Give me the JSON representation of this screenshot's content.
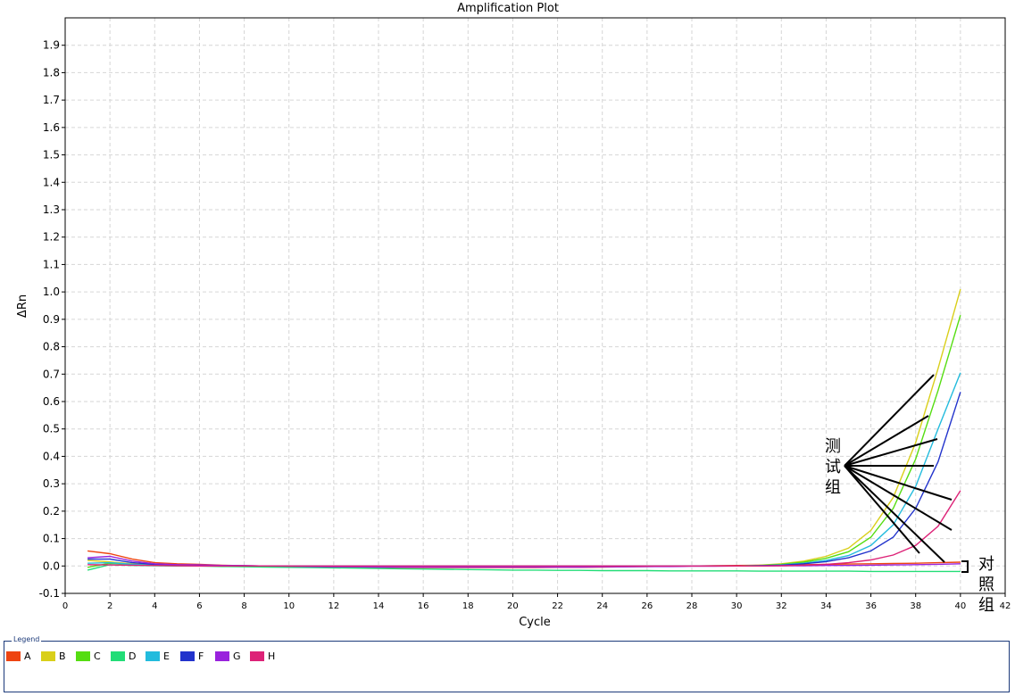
{
  "chart_data": {
    "type": "line",
    "title": "Amplification Plot",
    "xlabel": "Cycle",
    "ylabel": "ΔRn",
    "xlim": [
      0,
      42
    ],
    "ylim": [
      -0.1,
      2.0
    ],
    "xticks": [
      0,
      2,
      4,
      6,
      8,
      10,
      12,
      14,
      16,
      18,
      20,
      22,
      24,
      26,
      28,
      30,
      32,
      34,
      36,
      38,
      40,
      42
    ],
    "yticks": [
      -0.1,
      0.0,
      0.1,
      0.2,
      0.3,
      0.4,
      0.5,
      0.6,
      0.7,
      0.8,
      0.9,
      1.0,
      1.1,
      1.2,
      1.3,
      1.4,
      1.5,
      1.6,
      1.7,
      1.8,
      1.9
    ],
    "ytick_labels": [
      "-0.1",
      "0.0",
      "0.1",
      "0.2",
      "0.3",
      "0.4",
      "0.5",
      "0.6",
      "0.7",
      "0.8",
      "0.9",
      "1.0",
      "1.1",
      "1.2",
      "1.3",
      "1.4",
      "1.5",
      "1.6",
      "1.7",
      "1.8",
      "1.9"
    ],
    "grid": true,
    "x": [
      1,
      2,
      3,
      4,
      5,
      6,
      7,
      8,
      9,
      10,
      11,
      12,
      13,
      14,
      15,
      16,
      17,
      18,
      19,
      20,
      21,
      22,
      23,
      24,
      25,
      26,
      27,
      28,
      29,
      30,
      31,
      32,
      33,
      34,
      35,
      36,
      37,
      38,
      39,
      40
    ],
    "series": [
      {
        "name": "A",
        "color": "#ee4411",
        "values": [
          0.055,
          0.045,
          0.025,
          0.012,
          0.008,
          0.006,
          0.003,
          0.001,
          0.0,
          -0.002,
          -0.004,
          -0.005,
          -0.005,
          -0.006,
          -0.006,
          -0.006,
          -0.006,
          -0.006,
          -0.006,
          -0.006,
          -0.006,
          -0.005,
          -0.005,
          -0.004,
          -0.003,
          -0.002,
          -0.001,
          0.0,
          0.001,
          0.002,
          0.003,
          0.004,
          0.005,
          0.006,
          0.007,
          0.008,
          0.009,
          0.01,
          0.012,
          0.014
        ]
      },
      {
        "name": "B",
        "color": "#d9cf1a",
        "values": [
          0.02,
          0.015,
          0.008,
          0.005,
          0.003,
          0.002,
          0.001,
          0.0,
          0.0,
          0.0,
          0.0,
          0.0,
          0.0,
          0.0,
          0.0,
          0.0,
          0.0,
          0.0,
          0.0,
          0.0,
          0.0,
          0.0,
          0.0,
          0.0,
          0.0,
          0.0,
          0.0,
          0.0,
          0.0,
          0.0,
          0.003,
          0.008,
          0.018,
          0.035,
          0.065,
          0.13,
          0.25,
          0.45,
          0.72,
          1.01
        ]
      },
      {
        "name": "C",
        "color": "#55dd11",
        "values": [
          -0.005,
          0.01,
          0.006,
          0.003,
          0.002,
          0.001,
          0.0,
          0.0,
          0.0,
          0.0,
          0.0,
          0.0,
          0.0,
          0.0,
          0.0,
          0.0,
          0.0,
          0.0,
          0.0,
          0.0,
          0.0,
          0.0,
          0.0,
          0.0,
          0.0,
          0.0,
          0.0,
          0.0,
          0.0,
          0.0,
          0.002,
          0.006,
          0.014,
          0.028,
          0.052,
          0.105,
          0.21,
          0.39,
          0.64,
          0.915
        ]
      },
      {
        "name": "D",
        "color": "#22dd77",
        "values": [
          -0.015,
          0.005,
          0.002,
          0.001,
          0.0,
          0.0,
          -0.002,
          -0.003,
          -0.004,
          -0.005,
          -0.006,
          -0.007,
          -0.008,
          -0.009,
          -0.01,
          -0.011,
          -0.012,
          -0.013,
          -0.014,
          -0.015,
          -0.015,
          -0.016,
          -0.016,
          -0.017,
          -0.017,
          -0.017,
          -0.018,
          -0.018,
          -0.018,
          -0.018,
          -0.019,
          -0.019,
          -0.019,
          -0.019,
          -0.019,
          -0.02,
          -0.02,
          -0.02,
          -0.02,
          -0.02
        ]
      },
      {
        "name": "E",
        "color": "#22bbdd",
        "values": [
          0.01,
          0.012,
          0.006,
          0.003,
          0.002,
          0.001,
          0.0,
          0.0,
          0.0,
          0.0,
          0.0,
          0.0,
          0.0,
          0.0,
          0.0,
          0.0,
          0.0,
          0.0,
          0.0,
          0.0,
          0.0,
          0.0,
          0.0,
          0.0,
          0.0,
          0.0,
          0.0,
          0.0,
          0.0,
          0.0,
          0.001,
          0.004,
          0.01,
          0.02,
          0.038,
          0.075,
          0.15,
          0.29,
          0.5,
          0.705
        ]
      },
      {
        "name": "F",
        "color": "#2233cc",
        "values": [
          0.025,
          0.025,
          0.012,
          0.006,
          0.004,
          0.003,
          0.002,
          0.001,
          0.0,
          0.0,
          0.0,
          0.0,
          0.0,
          0.0,
          0.0,
          0.0,
          0.0,
          0.0,
          0.0,
          0.0,
          0.0,
          0.0,
          0.0,
          0.0,
          0.0,
          0.0,
          0.0,
          0.0,
          0.0,
          0.0,
          0.001,
          0.003,
          0.008,
          0.016,
          0.03,
          0.055,
          0.105,
          0.21,
          0.38,
          0.635
        ]
      },
      {
        "name": "G",
        "color": "#9922dd",
        "values": [
          0.03,
          0.035,
          0.018,
          0.008,
          0.005,
          0.004,
          0.002,
          0.001,
          0.0,
          -0.001,
          -0.002,
          -0.003,
          -0.003,
          -0.004,
          -0.004,
          -0.004,
          -0.004,
          -0.004,
          -0.004,
          -0.004,
          -0.004,
          -0.004,
          -0.004,
          -0.003,
          -0.003,
          -0.002,
          -0.002,
          -0.001,
          -0.001,
          0.0,
          0.0,
          0.001,
          0.001,
          0.002,
          0.002,
          0.003,
          0.004,
          0.005,
          0.006,
          0.008
        ]
      },
      {
        "name": "H",
        "color": "#dd2277",
        "values": [
          0.005,
          0.004,
          0.003,
          0.002,
          0.001,
          0.0,
          0.0,
          0.0,
          0.0,
          0.0,
          0.0,
          0.0,
          0.0,
          0.0,
          0.0,
          0.0,
          0.0,
          0.0,
          0.0,
          0.0,
          0.0,
          0.0,
          0.0,
          0.0,
          0.0,
          0.0,
          0.0,
          0.0,
          0.0,
          0.0,
          0.0,
          0.001,
          0.003,
          0.006,
          0.012,
          0.022,
          0.04,
          0.075,
          0.145,
          0.275
        ]
      }
    ],
    "annotations": [
      {
        "label": "测试组",
        "label_chars": [
          "测",
          "试",
          "组"
        ]
      },
      {
        "label": "对照组",
        "label_chars": [
          "对",
          "照",
          "组"
        ]
      }
    ]
  },
  "legend": {
    "title": "Legend",
    "items": [
      {
        "label": "A",
        "color": "#ee4411"
      },
      {
        "label": "B",
        "color": "#d9cf1a"
      },
      {
        "label": "C",
        "color": "#55dd11"
      },
      {
        "label": "D",
        "color": "#22dd77"
      },
      {
        "label": "E",
        "color": "#22bbdd"
      },
      {
        "label": "F",
        "color": "#2233cc"
      },
      {
        "label": "G",
        "color": "#9922dd"
      },
      {
        "label": "H",
        "color": "#dd2277"
      }
    ]
  }
}
